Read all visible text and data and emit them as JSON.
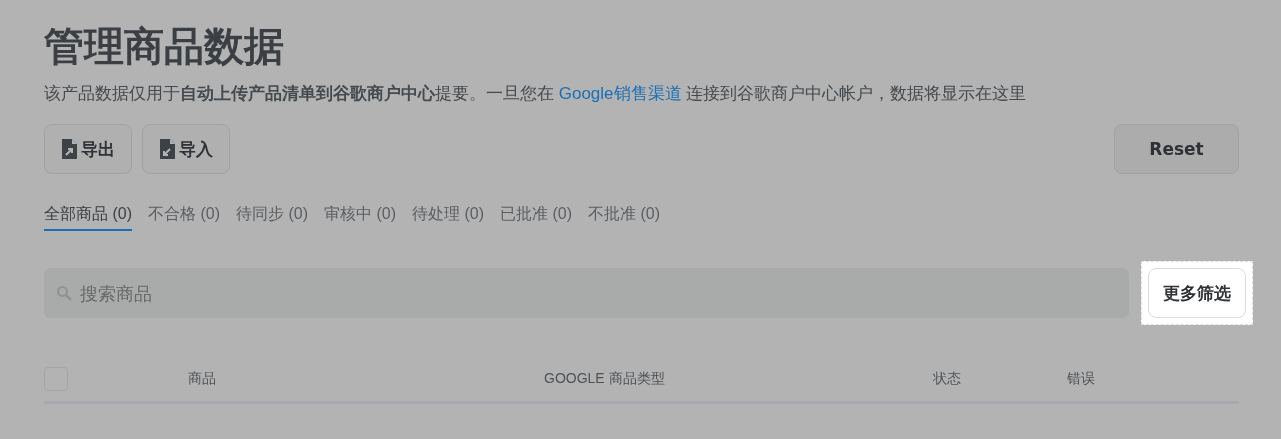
{
  "title": "管理商品数据",
  "description": {
    "text": "该产品数据仅用于**自动上传产品清单到谷歌商户中心**提要。一旦您在 ",
    "link": "Google销售渠道",
    "after": " 连接到谷歌商户中心帐户，数据将显示在这里"
  },
  "actions": [
    {
      "label": "导出",
      "kind": "export"
    },
    {
      "label": "导入",
      "kind": "import"
    }
  ],
  "reset_button": "Reset",
  "tabs": [
    {
      "label": "全部商品 (0)",
      "selected": true
    },
    {
      "label": "不合格 (0)",
      "selected": false
    },
    {
      "label": "待同步 (0)",
      "selected": false
    },
    {
      "label": "审核中 (0)",
      "selected": false
    },
    {
      "label": "待处理 (0)",
      "selected": false
    },
    {
      "label": "已批准 (0)",
      "selected": false
    },
    {
      "label": "不批准 (0)",
      "selected": false
    }
  ],
  "search": {
    "placeholder": "搜索商品"
  },
  "filter_button": {
    "label": "更多筛选",
    "highlighted": true
  },
  "table": {
    "select_all": {
      "checked": false
    },
    "columns": [
      "商品",
      "GOOGLE 商品类型",
      "状态",
      "错误"
    ]
  }
}
